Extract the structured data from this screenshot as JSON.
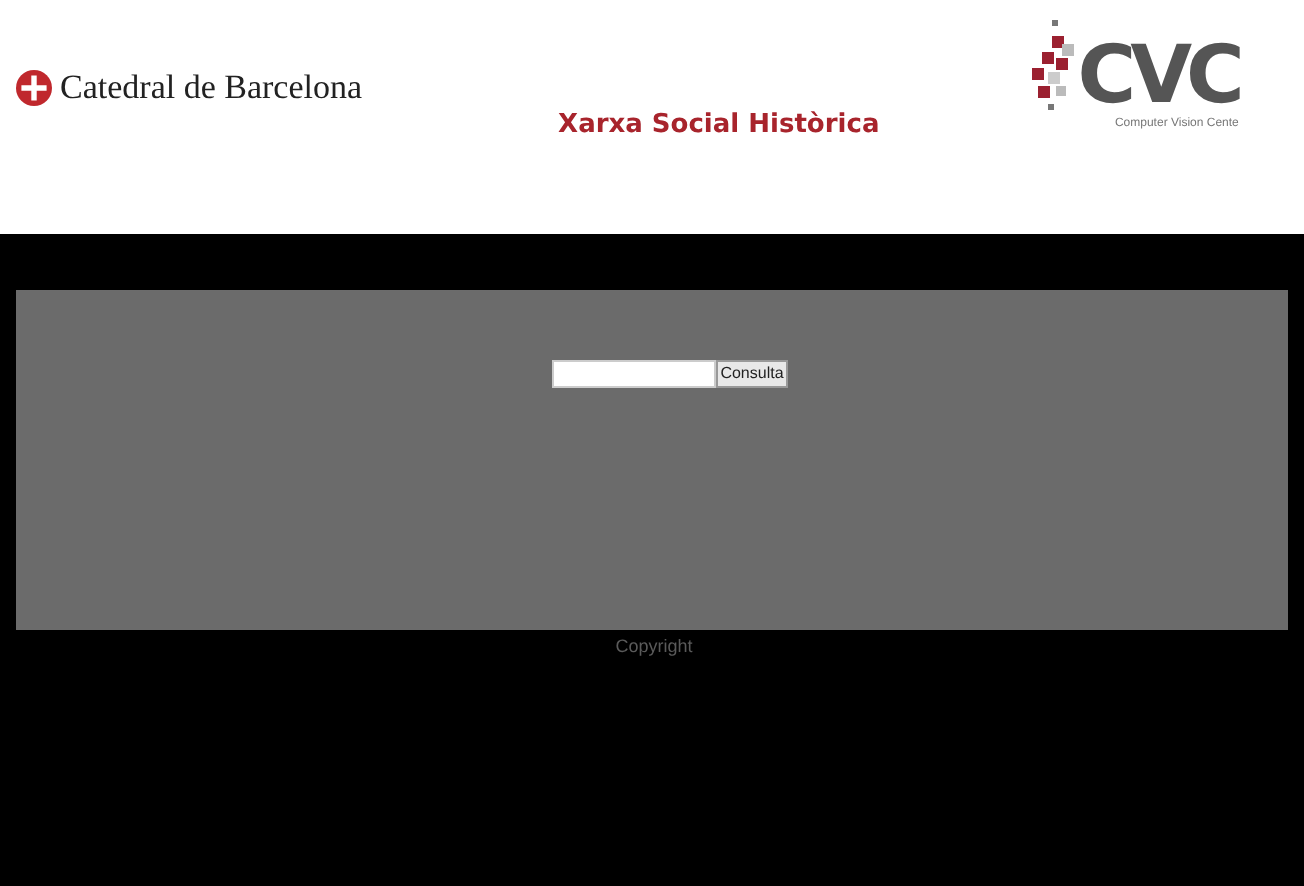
{
  "header": {
    "left_logo": "Catedral de Barcelona",
    "title": "Xarxa Social Històrica",
    "right_logo": {
      "mark": "CVC",
      "caption": "Computer Vision Cente"
    }
  },
  "search": {
    "button": "Consulta"
  },
  "footer": {
    "text": "Copyright"
  }
}
